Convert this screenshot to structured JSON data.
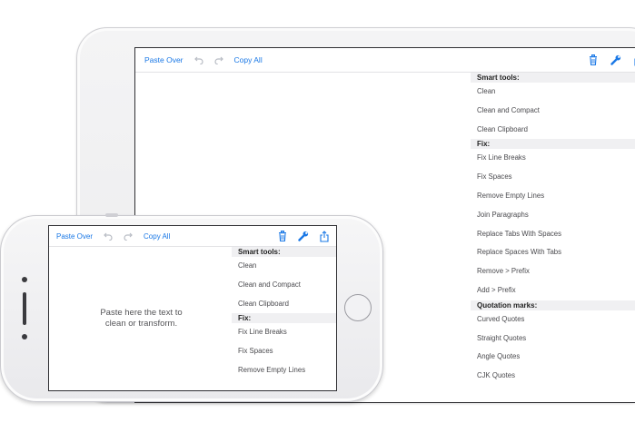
{
  "toolbar": {
    "paste_over": "Paste Over",
    "copy_all": "Copy All",
    "undo_icon": "undo-icon",
    "redo_icon": "redo-icon",
    "trash_icon": "trash-icon",
    "wrench_icon": "wrench-icon",
    "share_icon": "share-icon"
  },
  "placeholder": "Paste here the text to\nclean or transform.",
  "ipad_sidebar": [
    {
      "type": "section",
      "label": "Smart tools:"
    },
    {
      "type": "item",
      "label": "Clean"
    },
    {
      "type": "item",
      "label": "Clean and Compact"
    },
    {
      "type": "item",
      "label": "Clean Clipboard"
    },
    {
      "type": "section",
      "label": "Fix:"
    },
    {
      "type": "item",
      "label": "Fix Line Breaks"
    },
    {
      "type": "item",
      "label": "Fix Spaces"
    },
    {
      "type": "item",
      "label": "Remove Empty Lines"
    },
    {
      "type": "item",
      "label": "Join Paragraphs"
    },
    {
      "type": "item",
      "label": "Replace Tabs With Spaces"
    },
    {
      "type": "item",
      "label": "Replace Spaces With Tabs"
    },
    {
      "type": "item",
      "label": "Remove > Prefix"
    },
    {
      "type": "item",
      "label": "Add > Prefix"
    },
    {
      "type": "section",
      "label": "Quotation marks:"
    },
    {
      "type": "item",
      "label": "Curved Quotes"
    },
    {
      "type": "item",
      "label": "Straight Quotes"
    },
    {
      "type": "item",
      "label": "Angle Quotes"
    },
    {
      "type": "item",
      "label": "CJK Quotes"
    }
  ],
  "iphone_sidebar": [
    {
      "type": "section",
      "label": "Smart tools:"
    },
    {
      "type": "item",
      "label": "Clean"
    },
    {
      "type": "item",
      "label": "Clean and Compact"
    },
    {
      "type": "item",
      "label": "Clean Clipboard"
    },
    {
      "type": "section",
      "label": "Fix:"
    },
    {
      "type": "item",
      "label": "Fix Line Breaks"
    },
    {
      "type": "item",
      "label": "Fix Spaces"
    },
    {
      "type": "item",
      "label": "Remove Empty Lines"
    }
  ],
  "colors": {
    "accent": "#1a78e6",
    "section_bg": "#f0f0f2",
    "disabled_icon": "#b8bcc4"
  }
}
